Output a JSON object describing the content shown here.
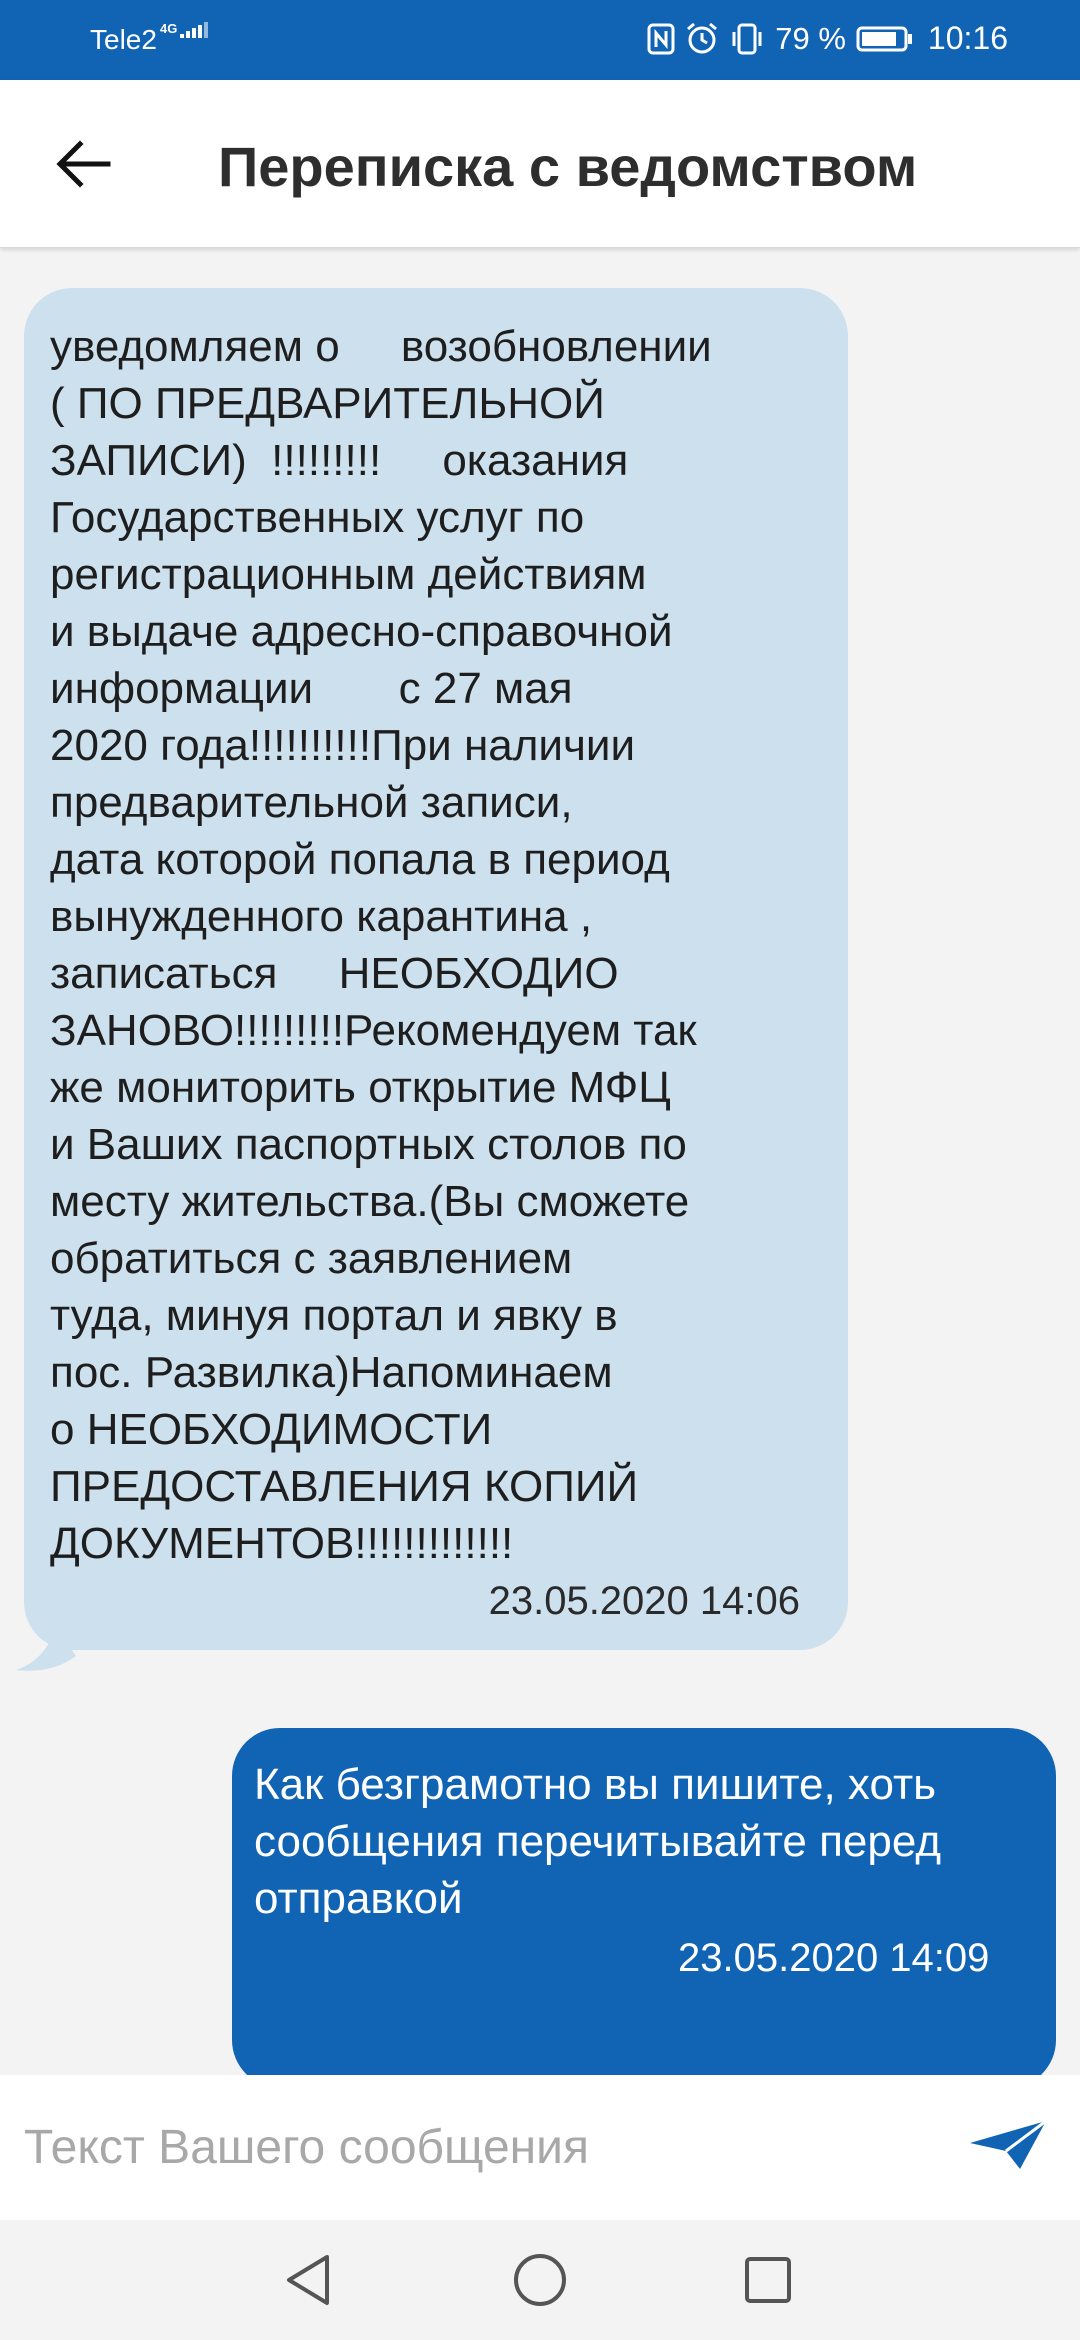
{
  "status_bar": {
    "carrier": "Tele2",
    "network_type": "4G",
    "battery_percent": "79 %",
    "time": "10:16",
    "icons": [
      "signal-icon",
      "nfc-icon",
      "alarm-icon",
      "vibrate-icon",
      "battery-icon"
    ]
  },
  "app_bar": {
    "title": "Переписка с ведомством",
    "back_icon": "back-arrow-icon"
  },
  "messages": [
    {
      "direction": "incoming",
      "text": "уведомляем о     возобновлении\n( ПО ПРЕДВАРИТЕЛЬНОЙ\nЗАПИСИ)  !!!!!!!!!     оказания\nГосударственных услуг по\nрегистрационным действиям\nи выдаче адресно-справочной\nинформации       с 27 мая\n2020 года!!!!!!!!!!При наличии\nпредварительной записи,\nдата которой попала в период\nвынужденного карантина ,\nзаписаться     НЕОБХОДИО\nЗАНОВО!!!!!!!!!Рекомендуем так\nже мониторить открытие МФЦ\nи Ваших паспортных столов по\nместу жительства.(Вы сможете\nобратиться с заявлением\nтуда, минуя портал и явку в\nпос. Развилка)Напоминаем\nо НЕОБХОДИМОСТИ\nПРЕДОСТАВЛЕНИЯ КОПИЙ\nДОКУМЕНТОВ!!!!!!!!!!!!!",
      "timestamp": "23.05.2020 14:06"
    },
    {
      "direction": "outgoing",
      "text": "Как безграмотно вы пишите, хоть сообщения перечитывайте перед отправкой",
      "timestamp": "23.05.2020 14:09"
    }
  ],
  "composer": {
    "placeholder": "Текст Вашего сообщения",
    "value": "",
    "send_icon": "send-icon"
  },
  "nav_bar": {
    "buttons": [
      "back-triangle-icon",
      "home-circle-icon",
      "recents-square-icon"
    ]
  },
  "colors": {
    "primary": "#1164b4",
    "incoming_bubble": "#cde0ee",
    "background": "#f3f3f3"
  }
}
